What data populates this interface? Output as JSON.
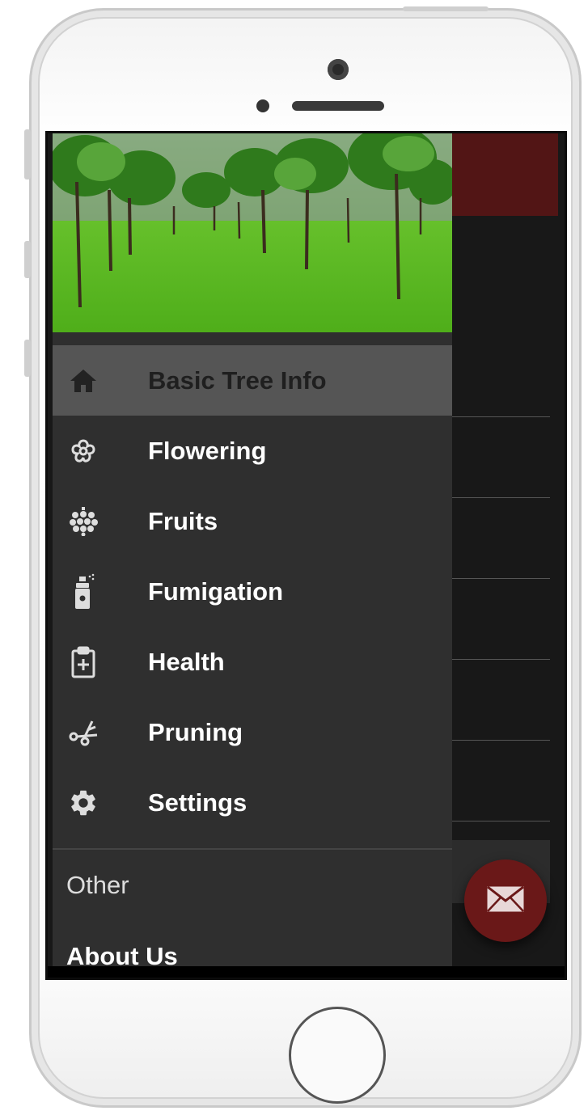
{
  "drawer": {
    "items": [
      {
        "label": "Basic Tree Info",
        "icon": "home-icon",
        "active": true
      },
      {
        "label": "Flowering",
        "icon": "flower-icon",
        "active": false
      },
      {
        "label": "Fruits",
        "icon": "raspberry-icon",
        "active": false
      },
      {
        "label": "Fumigation",
        "icon": "spray-can-icon",
        "active": false
      },
      {
        "label": "Health",
        "icon": "clipboard-plus-icon",
        "active": false
      },
      {
        "label": "Pruning",
        "icon": "scissors-icon",
        "active": false
      },
      {
        "label": "Settings",
        "icon": "gear-icon",
        "active": false
      }
    ],
    "section_title": "Other",
    "section_items": [
      {
        "label": "About Us"
      }
    ]
  },
  "colors": {
    "appbar": "#521515",
    "fab": "#6a1818",
    "drawer_bg": "#2f2f2f",
    "active_item_bg": "#555555",
    "icon": "#dddddd"
  },
  "fab": {
    "icon": "mail-icon"
  }
}
